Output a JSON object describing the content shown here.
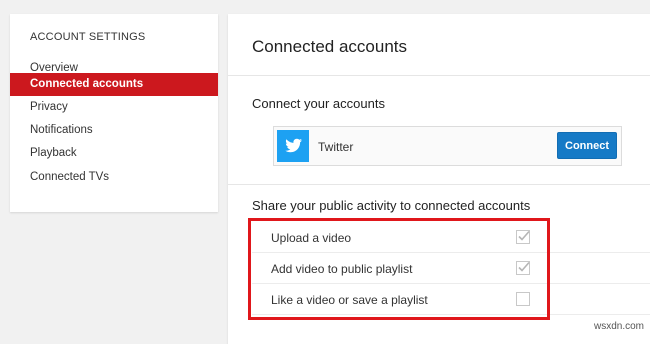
{
  "sidebar": {
    "heading": "ACCOUNT SETTINGS",
    "items": [
      {
        "label": "Overview",
        "active": false
      },
      {
        "label": "Connected accounts",
        "active": true
      },
      {
        "label": "Privacy",
        "active": false
      },
      {
        "label": "Notifications",
        "active": false
      },
      {
        "label": "Playback",
        "active": false
      },
      {
        "label": "Connected TVs",
        "active": false
      }
    ]
  },
  "main": {
    "title": "Connected accounts",
    "connect_section_title": "Connect your accounts",
    "account": {
      "name": "Twitter",
      "icon": "twitter-bird-icon",
      "button_label": "Connect"
    },
    "share_section_title": "Share your public activity to connected accounts",
    "share_options": [
      {
        "label": "Upload a video",
        "checked": true
      },
      {
        "label": "Add video to public playlist",
        "checked": true
      },
      {
        "label": "Like a video or save a playlist",
        "checked": false
      }
    ]
  },
  "colors": {
    "accent_red": "#cc181e",
    "button_blue": "#167ac6",
    "twitter_blue": "#1da1f2",
    "highlight_red": "#e0171b"
  },
  "watermark": "wsxdn.com"
}
